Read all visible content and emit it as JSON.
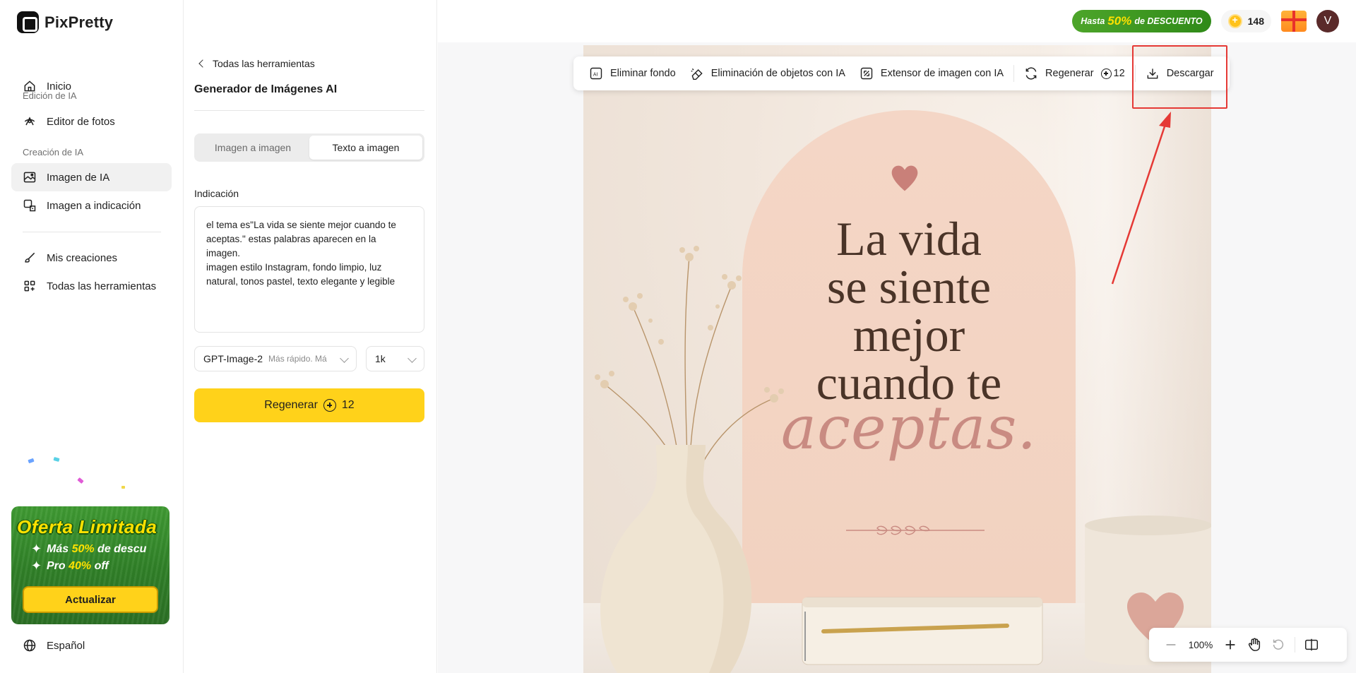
{
  "app": {
    "name": "PixPretty"
  },
  "sidebar": {
    "home": "Inicio",
    "section_edit": "Edición de IA",
    "photo_editor": "Editor de fotos",
    "section_create": "Creación de IA",
    "ai_image": "Imagen de IA",
    "image_to_prompt": "Imagen a indicación",
    "my_creations": "Mis creaciones",
    "all_tools": "Todas las herramientas",
    "language": "Español"
  },
  "promo": {
    "title": "Oferta Limitada",
    "line1_pre": "Más ",
    "line1_hl": "50%",
    "line1_post": " de descu",
    "line2_pre": "Pro ",
    "line2_hl": "40%",
    "line2_post": " off",
    "button": "Actualizar"
  },
  "header": {
    "discount_pre": "Hasta",
    "discount_big": "50%",
    "discount_post": "de DESCUENTO",
    "credits": "148",
    "avatar_initial": "V"
  },
  "panel": {
    "back": "Todas las herramientas",
    "title": "Generador de Imágenes AI",
    "tabs": [
      "Imagen a imagen",
      "Texto a imagen"
    ],
    "active_tab": 1,
    "prompt_label": "Indicación",
    "prompt_text": "el tema es\"La vida se siente mejor cuando te aceptas.\" estas palabras aparecen en la imagen.\nimagen estilo Instagram, fondo limpio, luz natural, tonos pastel, texto elegante y legible",
    "model": "GPT-Image-2",
    "model_desc": "Más rápido. Má",
    "resolution": "1k",
    "regen_label": "Regenerar",
    "regen_cost": "12"
  },
  "toolbar": {
    "remove_bg": "Eliminar fondo",
    "object_removal": "Eliminación de objetos con IA",
    "extender": "Extensor de imagen con IA",
    "regenerate": "Regenerar",
    "regenerate_cost": "12",
    "download": "Descargar"
  },
  "image": {
    "quote_lines": [
      "La vida",
      "se siente",
      "mejor",
      "cuando te"
    ],
    "quote_script": "aceptas."
  },
  "zoom": {
    "level": "100%"
  },
  "colors": {
    "accent": "#ffd21a",
    "highlight": "#e53935",
    "promo_green": "#3f9a32"
  }
}
